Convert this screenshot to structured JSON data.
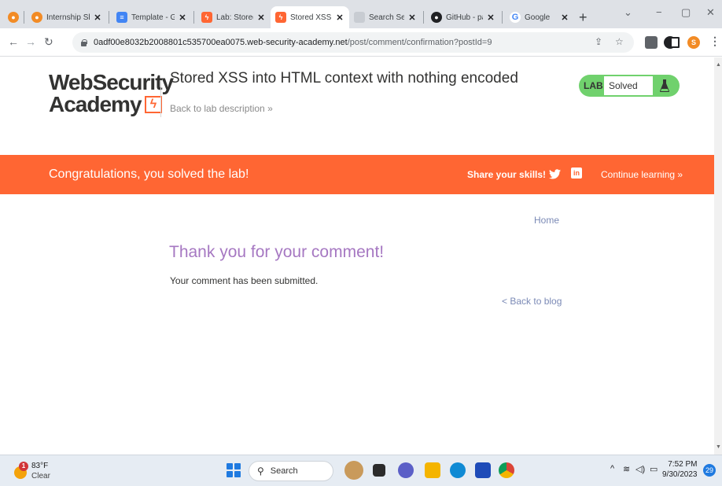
{
  "browser": {
    "tabs": [
      {
        "title": "",
        "icon": "extension-icon"
      },
      {
        "title": "Internship Sh",
        "icon": "internship-icon"
      },
      {
        "title": "Template - Go",
        "icon": "docs-icon"
      },
      {
        "title": "Lab: Stored X",
        "icon": "portswigger-icon"
      },
      {
        "title": "Stored XSS in",
        "icon": "portswigger-icon",
        "active": true
      },
      {
        "title": "Search Searc",
        "icon": "page-icon"
      },
      {
        "title": "GitHub - pay",
        "icon": "github-icon"
      },
      {
        "title": "Google",
        "icon": "google-icon"
      }
    ],
    "new_tab": "+",
    "url_host": "0adf00e8032b2008801c535700ea0075.web-security-academy.net",
    "url_path": "/post/comment/confirmation?postId=9",
    "profile_initial": "S"
  },
  "header": {
    "logo_line1": "WebSecurity",
    "logo_line2": "Academy",
    "lab_title": "Stored XSS into HTML context with nothing encoded",
    "back_to_description": "Back to lab description",
    "back_chevron": "»",
    "badge_label": "LAB",
    "badge_status": "Solved",
    "badge_color": "#70d16d"
  },
  "banner": {
    "message": "Congratulations, you solved the lab!",
    "share_label": "Share your skills!",
    "linkedin": "in",
    "continue_label": "Continue learning",
    "continue_chevron": "»",
    "color": "#ff6633"
  },
  "content": {
    "home_link": "Home",
    "heading": "Thank you for your comment!",
    "message": "Your comment has been submitted.",
    "back_link": "< Back to blog"
  },
  "taskbar": {
    "weather_badge": "1",
    "temperature": "83°F",
    "condition": "Clear",
    "search_label": "Search",
    "time": "7:52 PM",
    "date": "9/30/2023",
    "notifications": "29"
  }
}
